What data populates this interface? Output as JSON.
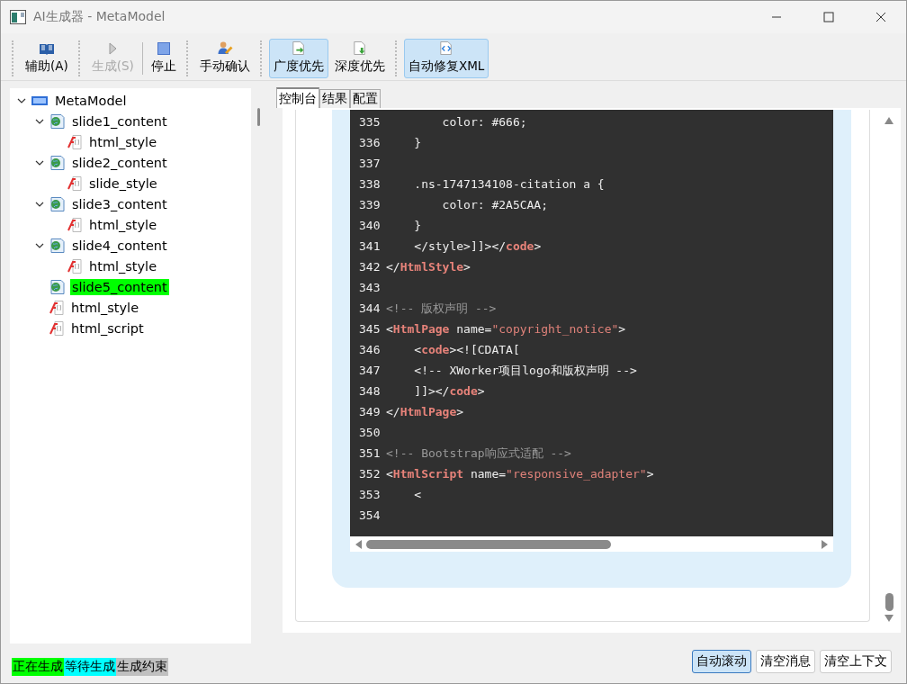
{
  "window": {
    "title": "AI生成器 - MetaModel"
  },
  "toolbar": [
    [
      {
        "kind": "book",
        "label": "辅助(A)",
        "disabled": false,
        "checked": false
      }
    ],
    [
      {
        "kind": "play",
        "label": "生成(S)",
        "disabled": true,
        "checked": false
      },
      {
        "kind": "stop",
        "label": "停止",
        "disabled": false,
        "checked": false
      }
    ],
    [
      {
        "kind": "person",
        "label": "手动确认",
        "disabled": false,
        "checked": false
      }
    ],
    [
      {
        "kind": "doc-right",
        "label": "广度优先",
        "disabled": false,
        "checked": true
      },
      {
        "kind": "doc-down",
        "label": "深度优先",
        "disabled": false,
        "checked": false
      }
    ],
    [
      {
        "kind": "doc-code",
        "label": "自动修复XML",
        "disabled": false,
        "checked": true
      }
    ]
  ],
  "tree": [
    {
      "kind": "root",
      "label": "MetaModel",
      "expanded": true,
      "selected": false,
      "children": [
        {
          "kind": "page",
          "label": "slide1_content",
          "expanded": true,
          "selected": false,
          "children": [
            {
              "kind": "style",
              "label": "html_style",
              "selected": false
            }
          ]
        },
        {
          "kind": "page",
          "label": "slide2_content",
          "expanded": true,
          "selected": false,
          "children": [
            {
              "kind": "style",
              "label": "slide_style",
              "selected": false
            }
          ]
        },
        {
          "kind": "page",
          "label": "slide3_content",
          "expanded": true,
          "selected": false,
          "children": [
            {
              "kind": "style",
              "label": "html_style",
              "selected": false
            }
          ]
        },
        {
          "kind": "page",
          "label": "slide4_content",
          "expanded": true,
          "selected": false,
          "children": [
            {
              "kind": "style",
              "label": "html_style",
              "selected": false
            }
          ]
        },
        {
          "kind": "page",
          "label": "slide5_content",
          "selected": true
        },
        {
          "kind": "style",
          "label": "html_style",
          "selected": false
        },
        {
          "kind": "style",
          "label": "html_script",
          "selected": false
        }
      ]
    }
  ],
  "tabs": [
    {
      "label": "控制台",
      "selected": true
    },
    {
      "label": "结果",
      "selected": false
    },
    {
      "label": "配置",
      "selected": false
    }
  ],
  "code": [
    {
      "number": "335",
      "tokens": [
        {
          "kind": "plain",
          "text": "        color: #666;"
        }
      ]
    },
    {
      "number": "336",
      "tokens": [
        {
          "kind": "plain",
          "text": "    }"
        }
      ]
    },
    {
      "number": "337"
    },
    {
      "number": "338",
      "tokens": [
        {
          "kind": "plain",
          "text": "    .ns-1747134108-citation a {"
        }
      ]
    },
    {
      "number": "339",
      "tokens": [
        {
          "kind": "plain",
          "text": "        color: #2A5CAA;"
        }
      ]
    },
    {
      "number": "340",
      "tokens": [
        {
          "kind": "plain",
          "text": "    }"
        }
      ]
    },
    {
      "number": "341",
      "tokens": [
        {
          "kind": "plain",
          "text": "    </style>]]></"
        },
        {
          "kind": "tag",
          "text": "code"
        },
        {
          "kind": "plain",
          "text": ">"
        }
      ]
    },
    {
      "number": "342",
      "tokens": [
        {
          "kind": "plain",
          "text": "</"
        },
        {
          "kind": "tag",
          "text": "HtmlStyle"
        },
        {
          "kind": "plain",
          "text": ">"
        }
      ]
    },
    {
      "number": "343"
    },
    {
      "number": "344",
      "tokens": [
        {
          "kind": "comment",
          "text": "<!-- 版权声明 -->"
        }
      ]
    },
    {
      "number": "345",
      "tokens": [
        {
          "kind": "plain",
          "text": "<"
        },
        {
          "kind": "tag",
          "text": "HtmlPage"
        },
        {
          "kind": "plain",
          "text": " name="
        },
        {
          "kind": "string",
          "text": "\"copyright_notice\""
        },
        {
          "kind": "plain",
          "text": ">"
        }
      ]
    },
    {
      "number": "346",
      "tokens": [
        {
          "kind": "plain",
          "text": "    <"
        },
        {
          "kind": "tag",
          "text": "code"
        },
        {
          "kind": "plain",
          "text": "><![CDATA["
        }
      ]
    },
    {
      "number": "347",
      "tokens": [
        {
          "kind": "plain",
          "text": "    <!-- XWorker项目logo和版权声明 -->"
        }
      ]
    },
    {
      "number": "348",
      "tokens": [
        {
          "kind": "plain",
          "text": "    ]]></"
        },
        {
          "kind": "tag",
          "text": "code"
        },
        {
          "kind": "plain",
          "text": ">"
        }
      ]
    },
    {
      "number": "349",
      "tokens": [
        {
          "kind": "plain",
          "text": "</"
        },
        {
          "kind": "tag",
          "text": "HtmlPage"
        },
        {
          "kind": "plain",
          "text": ">"
        }
      ]
    },
    {
      "number": "350"
    },
    {
      "number": "351",
      "tokens": [
        {
          "kind": "comment",
          "text": "<!-- Bootstrap响应式适配 -->"
        }
      ]
    },
    {
      "number": "352",
      "tokens": [
        {
          "kind": "plain",
          "text": "<"
        },
        {
          "kind": "tag",
          "text": "HtmlScript"
        },
        {
          "kind": "plain",
          "text": " name="
        },
        {
          "kind": "string",
          "text": "\"responsive_adapter\""
        },
        {
          "kind": "plain",
          "text": ">"
        }
      ]
    },
    {
      "number": "353",
      "tokens": [
        {
          "kind": "plain",
          "text": "    <"
        }
      ]
    },
    {
      "number": "354"
    }
  ],
  "legend": [
    {
      "label": "正在生成",
      "color": "#00ff00"
    },
    {
      "label": "等待生成",
      "color": "#00ffff"
    },
    {
      "label": "生成约束",
      "color": "#c0c0c0"
    }
  ],
  "buttons": [
    {
      "label": "自动滚动",
      "checked": true
    },
    {
      "label": "清空消息",
      "checked": false
    },
    {
      "label": "清空上下文",
      "checked": false
    }
  ]
}
